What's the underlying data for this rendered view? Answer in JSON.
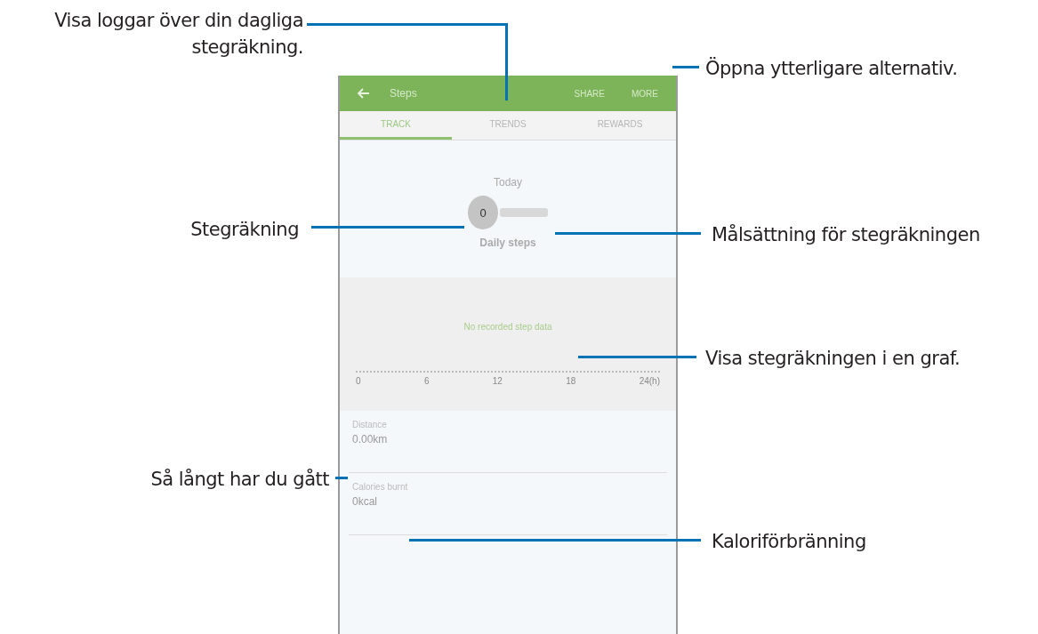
{
  "phone": {
    "app_bar": {
      "title": "Steps",
      "actions": [
        "SHARE",
        "MORE"
      ]
    },
    "tabs": [
      {
        "label": "TRACK",
        "selected": true
      },
      {
        "label": "TRENDS",
        "selected": false
      },
      {
        "label": "REWARDS",
        "selected": false
      }
    ],
    "today": {
      "label": "Today",
      "count": "0",
      "caption": "Daily steps"
    },
    "graph": {
      "message": "No recorded step data",
      "axis_labels": [
        "0",
        "6",
        "12",
        "18",
        "24(h)"
      ]
    },
    "stats": [
      {
        "label": "Distance",
        "value": "0.00km"
      },
      {
        "label": "Calories burnt",
        "value": "0kcal"
      }
    ]
  },
  "callouts": [
    {
      "text": "Visa loggar över din dagliga stegräkning."
    },
    {
      "text": "Öppna ytterligare alternativ."
    },
    {
      "text": "Stegräkning"
    },
    {
      "text": "Målsättning för stegräkningen"
    },
    {
      "text": "Visa stegräkningen i en graf."
    },
    {
      "text": "Så långt har du gått"
    },
    {
      "text": "Kaloriförbränning"
    }
  ]
}
